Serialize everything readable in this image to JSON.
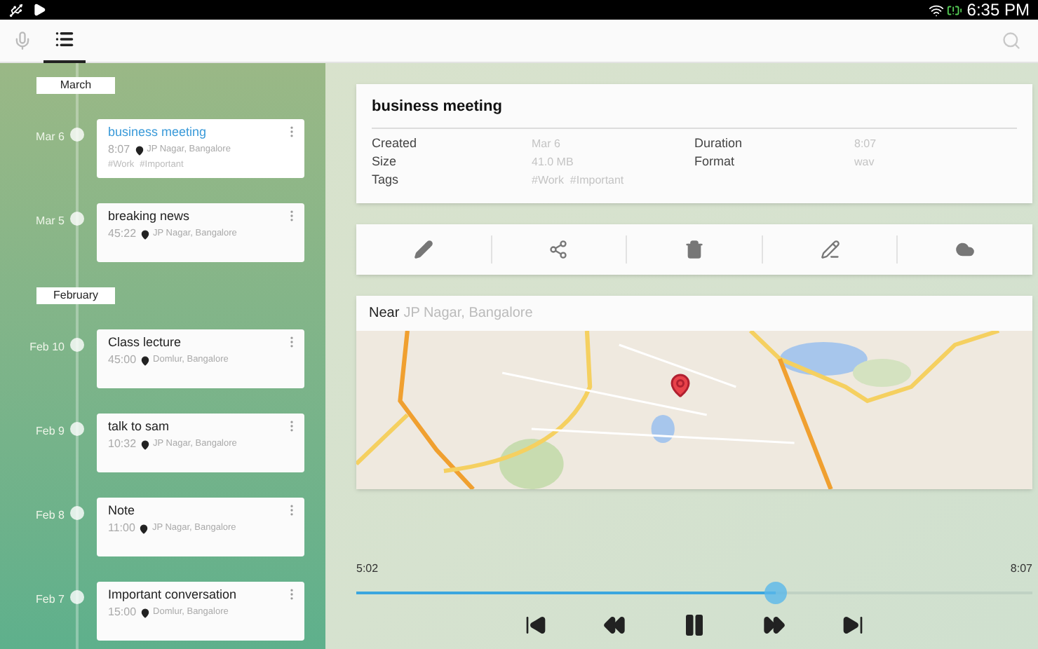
{
  "status_bar": {
    "time": "6:35 PM"
  },
  "toolbar": {
    "tabs": [
      {
        "kind": "mic",
        "selected": false
      },
      {
        "kind": "list",
        "selected": true
      }
    ]
  },
  "timeline": [
    {
      "month": "March",
      "entries": [
        {
          "date": "Mar 6",
          "title": "business meeting",
          "duration": "8:07",
          "location": "JP Nagar, Bangalore",
          "tags": [
            "#Work",
            "#Important"
          ],
          "selected": true
        },
        {
          "date": "Mar 5",
          "title": "breaking news",
          "duration": "45:22",
          "location": "JP Nagar, Bangalore",
          "selected": false
        }
      ]
    },
    {
      "month": "February",
      "entries": [
        {
          "date": "Feb 10",
          "title": "Class lecture",
          "duration": "45:00",
          "location": "Domlur, Bangalore",
          "selected": false
        },
        {
          "date": "Feb 9",
          "title": "talk to sam",
          "duration": "10:32",
          "location": "JP Nagar, Bangalore",
          "selected": false
        },
        {
          "date": "Feb 8",
          "title": "Note",
          "duration": "11:00",
          "location": "JP Nagar, Bangalore",
          "selected": false
        },
        {
          "date": "Feb 7",
          "title": "Important conversation",
          "duration": "15:00",
          "location": "Domlur, Bangalore",
          "selected": false
        }
      ]
    }
  ],
  "details": {
    "title": "business meeting",
    "left_fields": [
      {
        "label": "Created",
        "value": "Mar 6"
      },
      {
        "label": "Size",
        "value": "41.0 MB"
      },
      {
        "label": "Tags",
        "value": "#Work  #Important"
      }
    ],
    "right_fields": [
      {
        "label": "Duration",
        "value": "8:07"
      },
      {
        "label": "Format",
        "value": "wav"
      }
    ]
  },
  "actions": [
    {
      "kind": "edit"
    },
    {
      "kind": "share"
    },
    {
      "kind": "delete"
    },
    {
      "kind": "rename"
    },
    {
      "kind": "cloud"
    }
  ],
  "map": {
    "label": "Near",
    "place": "JP Nagar, Bangalore"
  },
  "player": {
    "elapsed": "5:02",
    "total": "8:07",
    "level": 0.62,
    "playing": true
  }
}
